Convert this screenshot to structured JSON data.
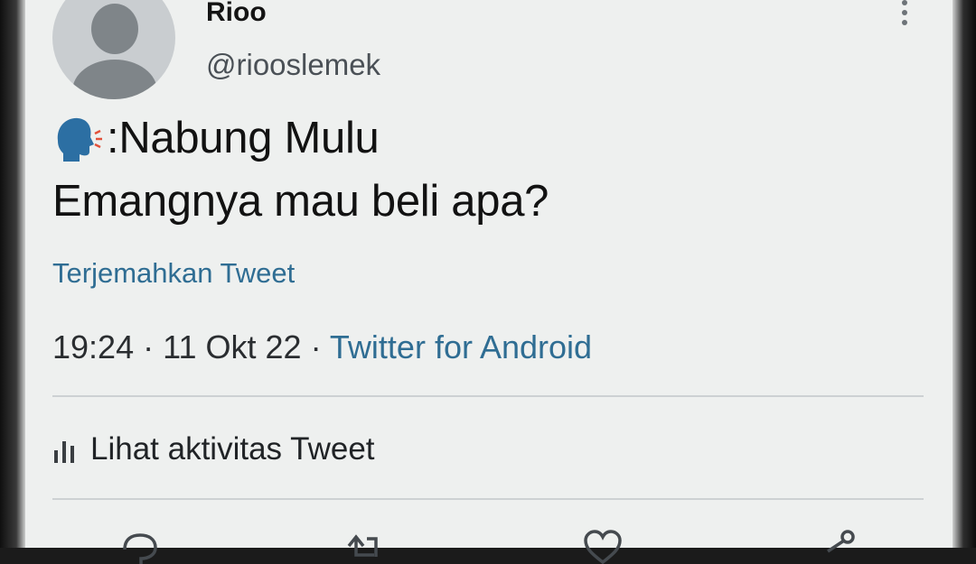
{
  "user": {
    "display_name": "Rioo",
    "handle": "@riooslemek",
    "avatar_icon": "default-avatar-icon"
  },
  "tweet": {
    "emoji_icon": "speaking-head-icon",
    "line1": ":Nabung Mulu",
    "line2": "Emangnya mau beli apa?",
    "translate_label": "Terjemahkan Tweet",
    "time": "19:24",
    "date": "11 Okt 22",
    "separator": "·",
    "source": "Twitter for Android",
    "activity_label": "Lihat aktivitas Tweet"
  },
  "colors": {
    "link": "#2f6d93",
    "text": "#121212",
    "background": "#eef0ef"
  },
  "actions": [
    "reply-icon",
    "retweet-icon",
    "like-icon",
    "share-icon"
  ]
}
